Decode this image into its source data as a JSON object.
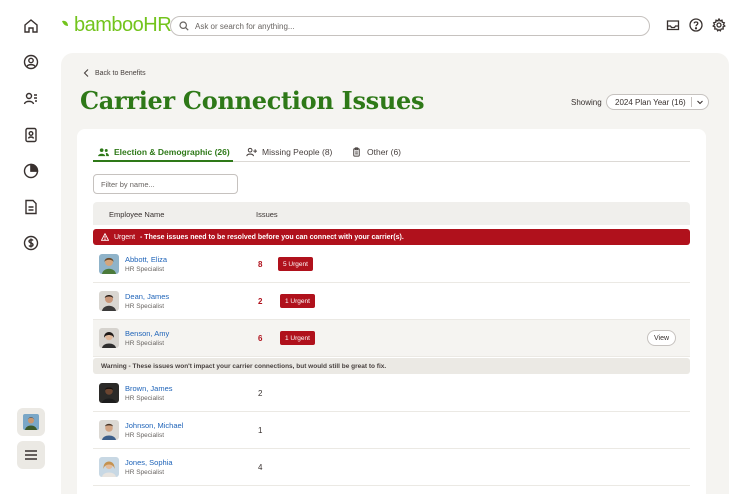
{
  "app": {
    "logo": "bambooHR"
  },
  "search": {
    "placeholder": "Ask or search for anything..."
  },
  "rail": {
    "icons": [
      "home-icon",
      "person-circle-icon",
      "people-icon",
      "badge-icon",
      "pie-chart-icon",
      "document-icon",
      "dollar-icon"
    ]
  },
  "header": {
    "back_label": "Back to Benefits",
    "title": "Carrier Connection Issues",
    "showing_label": "Showing",
    "plan_year": "2024 Plan Year (16)"
  },
  "tabs": [
    {
      "label": "Election & Demographic (26)",
      "icon": "people-icon",
      "active": true
    },
    {
      "label": "Missing People (8)",
      "icon": "person-add-icon",
      "active": false
    },
    {
      "label": "Other (6)",
      "icon": "clipboard-icon",
      "active": false
    }
  ],
  "filter": {
    "placeholder": "Filter by name..."
  },
  "table": {
    "headers": {
      "name": "Employee Name",
      "issues": "Issues"
    },
    "urgent": {
      "label": "Urgent",
      "message": "- These issues need to be resolved before you can connect with your carrier(s)."
    },
    "warning": {
      "message": "Warning - These issues won't impact your carrier connections, but would still be great to fix."
    },
    "urgent_rows": [
      {
        "name": "Abbott, Eliza",
        "title": "HR Specialist",
        "issues": "8",
        "badge": "5 Urgent"
      },
      {
        "name": "Dean, James",
        "title": "HR Specialist",
        "issues": "2",
        "badge": "1 Urgent"
      },
      {
        "name": "Benson, Amy",
        "title": "HR Specialist",
        "issues": "6",
        "badge": "1 Urgent",
        "action": "View"
      }
    ],
    "warning_rows": [
      {
        "name": "Brown, James",
        "title": "HR Specialist",
        "issues": "2"
      },
      {
        "name": "Johnson, Michael",
        "title": "HR Specialist",
        "issues": "1"
      },
      {
        "name": "Jones, Sophia",
        "title": "HR Specialist",
        "issues": "4"
      }
    ]
  },
  "colors": {
    "brand_green": "#2e7918",
    "logo_green": "#73c41d",
    "urgent_red": "#b0111c",
    "link_blue": "#1e63b8"
  }
}
